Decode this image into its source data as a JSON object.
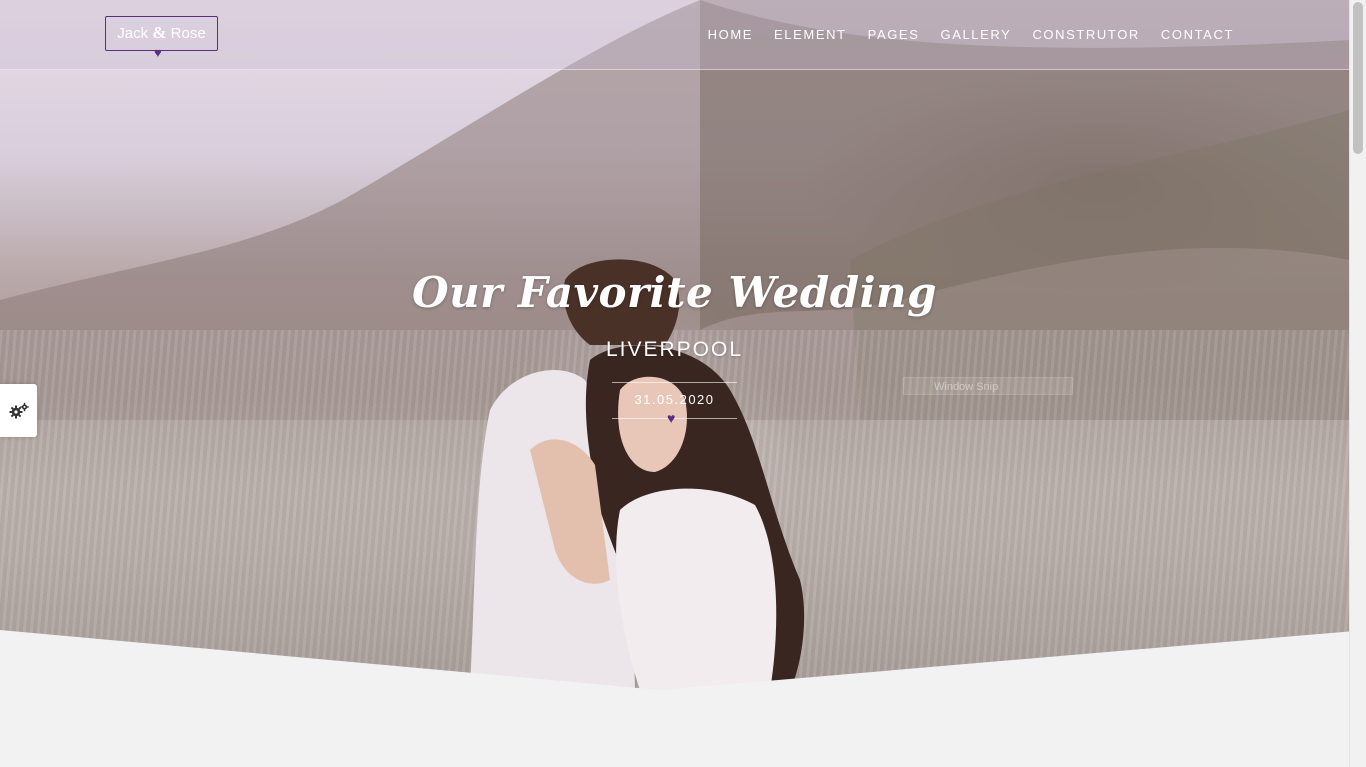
{
  "header": {
    "logo": {
      "name_left": "Jack",
      "amp": "&",
      "name_right": "Rose"
    },
    "nav": [
      {
        "label": "HOME"
      },
      {
        "label": "ELEMENT"
      },
      {
        "label": "PAGES"
      },
      {
        "label": "GALLERY"
      },
      {
        "label": "CONSTRUTOR"
      },
      {
        "label": "CONTACT"
      }
    ]
  },
  "hero": {
    "title": "Our Favorite Wedding",
    "subtitle": "LIVERPOOL",
    "date": "31.05.2020"
  },
  "overlay": {
    "snip_text": "Window Snip"
  },
  "colors": {
    "accent": "#5b2d82",
    "text_light": "#ffffff",
    "page_background": "#f3f2f3"
  },
  "icons": {
    "logo_heart": "heart-icon",
    "date_heart": "heart-icon",
    "settings": "gears-icon"
  }
}
